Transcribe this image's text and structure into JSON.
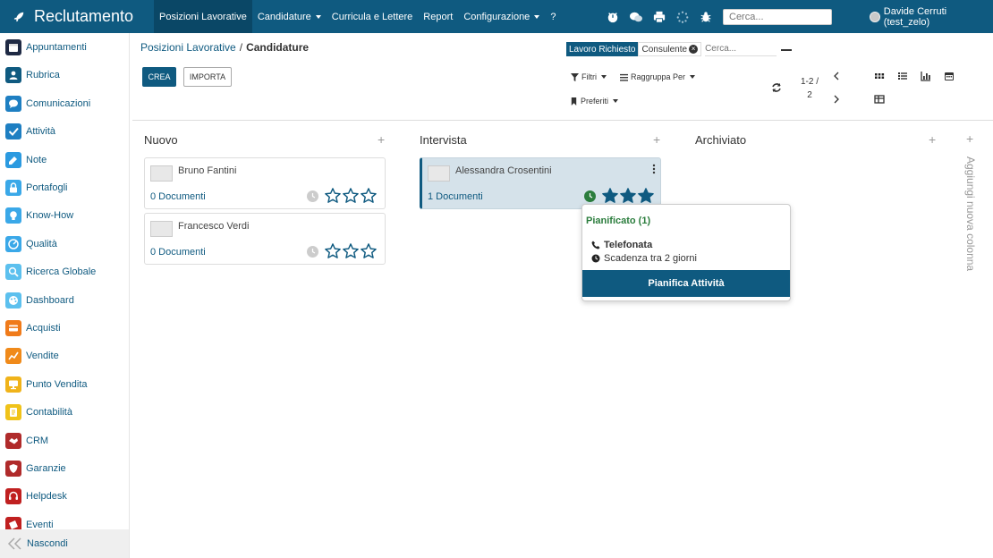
{
  "app": {
    "title": "Reclutamento"
  },
  "topnav": {
    "items": [
      {
        "label": "Posizioni Lavorative",
        "active": true,
        "dropdown": false
      },
      {
        "label": "Candidature",
        "active": false,
        "dropdown": true
      },
      {
        "label": "Curricula e Lettere",
        "active": false,
        "dropdown": false
      },
      {
        "label": "Report",
        "active": false,
        "dropdown": false
      },
      {
        "label": "Configurazione",
        "active": false,
        "dropdown": true
      },
      {
        "label": "?",
        "active": false,
        "dropdown": false
      }
    ],
    "icons": [
      "activity-icon",
      "chat-icon",
      "print-icon",
      "loading-icon",
      "bug-icon"
    ],
    "search_placeholder": "Cerca...",
    "user": "Davide Cerruti (test_zelo)"
  },
  "sidebar": {
    "items": [
      {
        "label": "Appuntamenti",
        "icon": "calendar-icon",
        "color": "#1f2a44"
      },
      {
        "label": "Rubrica",
        "icon": "contacts-icon",
        "color": "#0f5a80"
      },
      {
        "label": "Comunicazioni",
        "icon": "chat-icon",
        "color": "#1e7fc2"
      },
      {
        "label": "Attività",
        "icon": "check-icon",
        "color": "#1e7fc2"
      },
      {
        "label": "Note",
        "icon": "pen-icon",
        "color": "#2b9ae0"
      },
      {
        "label": "Portafogli",
        "icon": "lock-icon",
        "color": "#3aa8e8"
      },
      {
        "label": "Know-How",
        "icon": "bulb-icon",
        "color": "#3aa8e8"
      },
      {
        "label": "Qualità",
        "icon": "gauge-icon",
        "color": "#3aa8e8"
      },
      {
        "label": "Ricerca Globale",
        "icon": "search-icon",
        "color": "#5cc0ee"
      },
      {
        "label": "Dashboard",
        "icon": "palette-icon",
        "color": "#5cc0ee"
      },
      {
        "label": "Acquisti",
        "icon": "card-icon",
        "color": "#f07b1a"
      },
      {
        "label": "Vendite",
        "icon": "chart-icon",
        "color": "#f08a1a"
      },
      {
        "label": "Punto Vendita",
        "icon": "monitor-icon",
        "color": "#f0b31a"
      },
      {
        "label": "Contabilità",
        "icon": "ledger-icon",
        "color": "#f0c31a"
      },
      {
        "label": "CRM",
        "icon": "handshake-icon",
        "color": "#b02b2b"
      },
      {
        "label": "Garanzie",
        "icon": "shield-icon",
        "color": "#b02b2b"
      },
      {
        "label": "Helpdesk",
        "icon": "headset-icon",
        "color": "#c02020"
      },
      {
        "label": "Eventi",
        "icon": "ticket-icon",
        "color": "#c02020"
      }
    ],
    "hide_label": "Nascondi"
  },
  "control_panel": {
    "breadcrumb": {
      "parent": "Posizioni Lavorative",
      "separator": "/",
      "current": "Candidature"
    },
    "create_label": "CREA",
    "import_label": "IMPORTA",
    "facets": {
      "first": "Lavoro Richiesto",
      "second": "Consulente"
    },
    "search_placeholder": "Cerca...",
    "filters_label": "Filtri",
    "groupby_label": "Raggruppa Per",
    "favorites_label": "Preferiti",
    "pager": {
      "line1": "1-2 /",
      "line2": "2"
    },
    "views": [
      "kanban-view-icon",
      "list-view-icon",
      "graph-view-icon",
      "calendar-view-icon",
      "pivot-view-icon"
    ]
  },
  "kanban": {
    "columns": [
      {
        "title": "Nuovo",
        "cards": [
          {
            "name": "Bruno Fantini",
            "docs": "0 Documenti",
            "stars": 0,
            "activity": "none"
          },
          {
            "name": "Francesco Verdi",
            "docs": "0 Documenti",
            "stars": 0,
            "activity": "none"
          }
        ]
      },
      {
        "title": "Intervista",
        "cards": [
          {
            "name": "Alessandra Crosentini",
            "docs": "1 Documenti",
            "stars": 3,
            "activity": "planned"
          }
        ]
      },
      {
        "title": "Archiviato",
        "cards": []
      }
    ],
    "add_column_label": "Aggiungi nuova colonna"
  },
  "popover": {
    "title": "Pianificato (1)",
    "activity_type": "Telefonata",
    "deadline": "Scadenza tra 2 giorni",
    "button_label": "Pianifica Attività"
  },
  "colors": {
    "brand": "#0f5a80",
    "brand_dark": "#0a4766",
    "planned": "#2b7d3d",
    "selected_card": "#d5e2ea"
  }
}
